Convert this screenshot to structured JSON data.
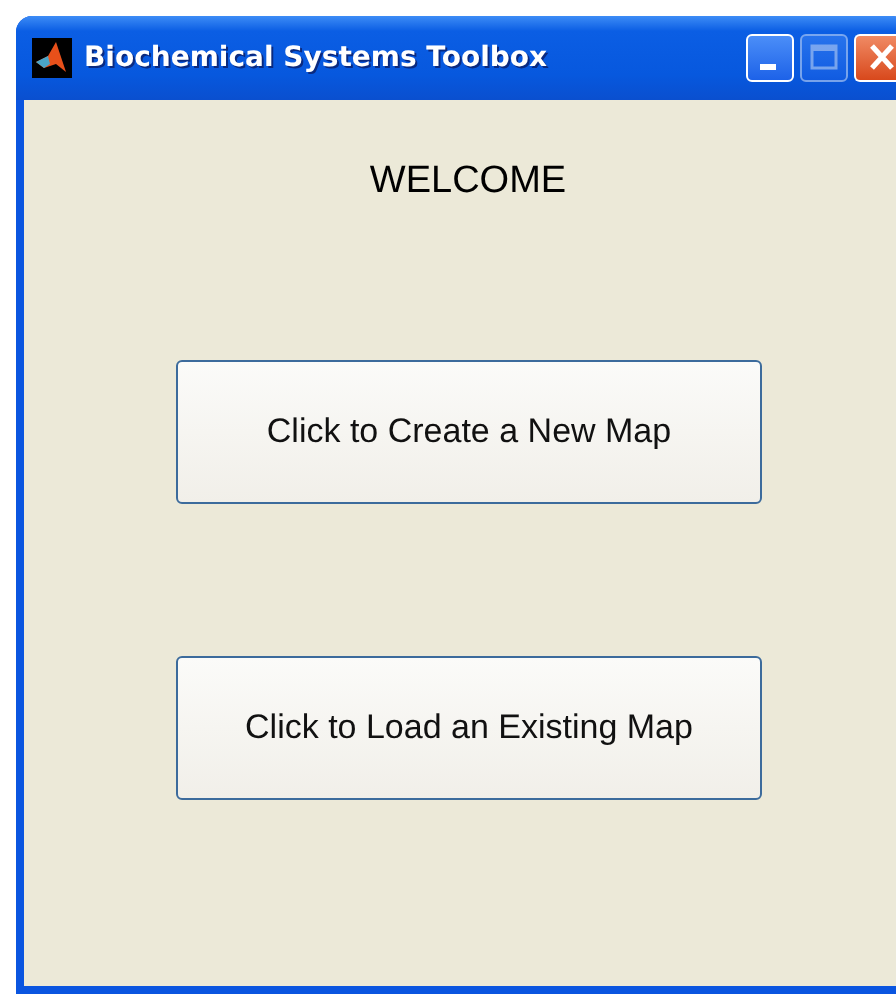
{
  "window": {
    "title": "Biochemical Systems Toolbox",
    "controls": [
      {
        "kind": "minimize",
        "disabled": false
      },
      {
        "kind": "maximize",
        "disabled": true
      },
      {
        "kind": "close",
        "disabled": false
      }
    ]
  },
  "heading": "WELCOME",
  "buttons": [
    "Click to Create a New Map",
    "Click to Load an Existing Map"
  ]
}
